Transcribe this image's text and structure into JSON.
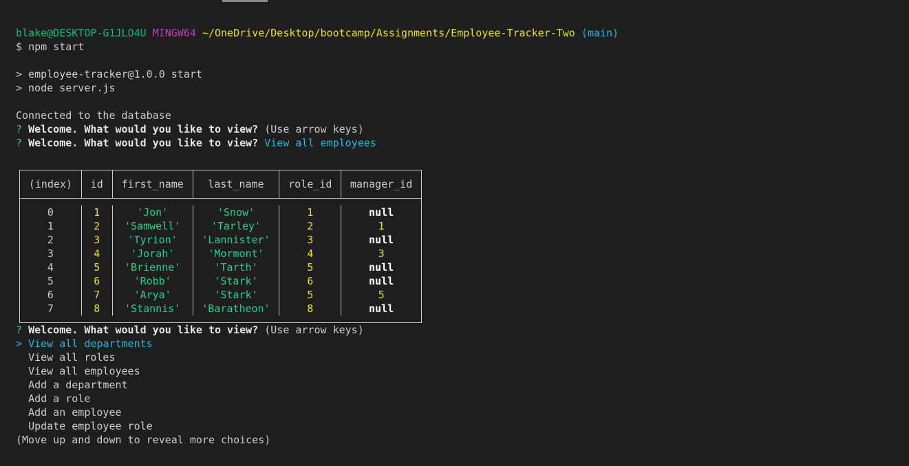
{
  "prompt": {
    "user_host": "blake@DESKTOP-G1JLO4U",
    "shell": "MINGW64",
    "path": "~/OneDrive/Desktop/bootcamp/Assignments/Employee-Tracker-Two",
    "branch": "(main)",
    "symbol": "$",
    "command": "npm start"
  },
  "npm_output": {
    "line1": "> employee-tracker@1.0.0 start",
    "line2": "> node server.js"
  },
  "connected": "Connected to the database",
  "question1": {
    "mark": "?",
    "text": "Welcome. What would you like to view?",
    "hint": "(Use arrow keys)"
  },
  "question2": {
    "mark": "?",
    "text": "Welcome. What would you like to view?",
    "answer": "View all employees"
  },
  "table": {
    "headers": [
      "(index)",
      "id",
      "first_name",
      "last_name",
      "role_id",
      "manager_id"
    ],
    "rows": [
      {
        "index": "0",
        "id": "1",
        "first_name": "'Jon'",
        "last_name": "'Snow'",
        "role_id": "1",
        "manager_id": "null"
      },
      {
        "index": "1",
        "id": "2",
        "first_name": "'Samwell'",
        "last_name": "'Tarley'",
        "role_id": "2",
        "manager_id": "1"
      },
      {
        "index": "2",
        "id": "3",
        "first_name": "'Tyrion'",
        "last_name": "'Lannister'",
        "role_id": "3",
        "manager_id": "null"
      },
      {
        "index": "3",
        "id": "4",
        "first_name": "'Jorah'",
        "last_name": "'Mormont'",
        "role_id": "4",
        "manager_id": "3"
      },
      {
        "index": "4",
        "id": "5",
        "first_name": "'Brienne'",
        "last_name": "'Tarth'",
        "role_id": "5",
        "manager_id": "null"
      },
      {
        "index": "5",
        "id": "6",
        "first_name": "'Robb'",
        "last_name": "'Stark'",
        "role_id": "6",
        "manager_id": "null"
      },
      {
        "index": "6",
        "id": "7",
        "first_name": "'Arya'",
        "last_name": "'Stark'",
        "role_id": "5",
        "manager_id": "5"
      },
      {
        "index": "7",
        "id": "8",
        "first_name": "'Stannis'",
        "last_name": "'Baratheon'",
        "role_id": "8",
        "manager_id": "null"
      }
    ]
  },
  "question3": {
    "mark": "?",
    "text": "Welcome. What would you like to view?",
    "hint": "(Use arrow keys)"
  },
  "menu": {
    "pointer": ">",
    "selected": "View all departments",
    "options": [
      "View all roles",
      "View all employees",
      "Add a department",
      "Add a role",
      "Add an employee",
      "Update employee role"
    ],
    "more_hint": "(Move up and down to reveal more choices)"
  },
  "colors": {
    "background": "#1e1e1e",
    "text": "#cccccc",
    "green": "#23d18b",
    "magenta": "#bc3fbc",
    "yellow": "#e5e510",
    "cyan": "#29b8db"
  }
}
